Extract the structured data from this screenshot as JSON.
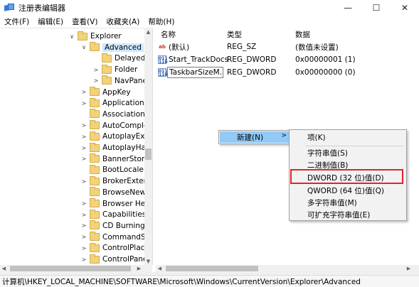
{
  "window": {
    "title": "注册表编辑器",
    "minimize": "—",
    "maximize": "☐",
    "close": "✕"
  },
  "menu": [
    "文件(F)",
    "编辑(E)",
    "查看(V)",
    "收藏夹(A)",
    "帮助(H)"
  ],
  "tree": [
    {
      "label": "Explorer",
      "chevron": "∨",
      "level": 0
    },
    {
      "label": "Advanced",
      "chevron": "∨",
      "level": 1,
      "selected": true
    },
    {
      "label": "DelayedAp",
      "chevron": "",
      "level": 2
    },
    {
      "label": "Folder",
      "chevron": ">",
      "level": 2
    },
    {
      "label": "NavPane",
      "chevron": ">",
      "level": 2
    },
    {
      "label": "AppKey",
      "chevron": ">",
      "level": 1
    },
    {
      "label": "ApplicationDe",
      "chevron": ">",
      "level": 1
    },
    {
      "label": "Associations",
      "chevron": "",
      "level": 1
    },
    {
      "label": "AutoComplete",
      "chevron": ">",
      "level": 1
    },
    {
      "label": "AutoplayExter",
      "chevron": ">",
      "level": 1
    },
    {
      "label": "AutoplayHanc",
      "chevron": ">",
      "level": 1
    },
    {
      "label": "BannerStore",
      "chevron": ">",
      "level": 1
    },
    {
      "label": "BootLocale",
      "chevron": "",
      "level": 1
    },
    {
      "label": "BrokerExtens",
      "chevron": ">",
      "level": 1
    },
    {
      "label": "BrowseNewPr",
      "chevron": "",
      "level": 1
    },
    {
      "label": "Browser Help",
      "chevron": ">",
      "level": 1
    },
    {
      "label": "Capabilities",
      "chevron": ">",
      "level": 1
    },
    {
      "label": "CD Burning",
      "chevron": ">",
      "level": 1
    },
    {
      "label": "CommandSto",
      "chevron": ">",
      "level": 1
    },
    {
      "label": "ControlPlace",
      "chevron": ">",
      "level": 1
    },
    {
      "label": "ControlPanel",
      "chevron": ">",
      "level": 1
    }
  ],
  "list": {
    "headers": {
      "name": "名称",
      "type": "类型",
      "data": "数据"
    },
    "rows": [
      {
        "icon": "ab",
        "name": "(默认)",
        "type": "REG_SZ",
        "data": "(数值未设置)"
      },
      {
        "icon": "bin",
        "name": "Start_TrackDocs",
        "type": "REG_DWORD",
        "data": "0x00000001 (1)"
      },
      {
        "icon": "bin",
        "name": "TaskbarSizeM...",
        "type": "REG_DWORD",
        "data": "0x00000000 (0)",
        "renaming": true
      }
    ]
  },
  "context_menu": {
    "new_label": "新建(N)",
    "arrow": ">"
  },
  "submenu": [
    {
      "label": "项(K)"
    },
    {
      "label": "字符串值(S)"
    },
    {
      "label": "二进制值(B)"
    },
    {
      "label": "DWORD (32 位)值(D)",
      "highlighted": true
    },
    {
      "label": "QWORD (64 位)值(Q)"
    },
    {
      "label": "多字符串值(M)"
    },
    {
      "label": "可扩充字符串值(E)"
    }
  ],
  "status": "计算机\\HKEY_LOCAL_MACHINE\\SOFTWARE\\Microsoft\\Windows\\CurrentVersion\\Explorer\\Advanced",
  "colors": {
    "selection": "#cce8ff",
    "menu_hover": "#91c9f7",
    "annotation": "#e0242a"
  }
}
